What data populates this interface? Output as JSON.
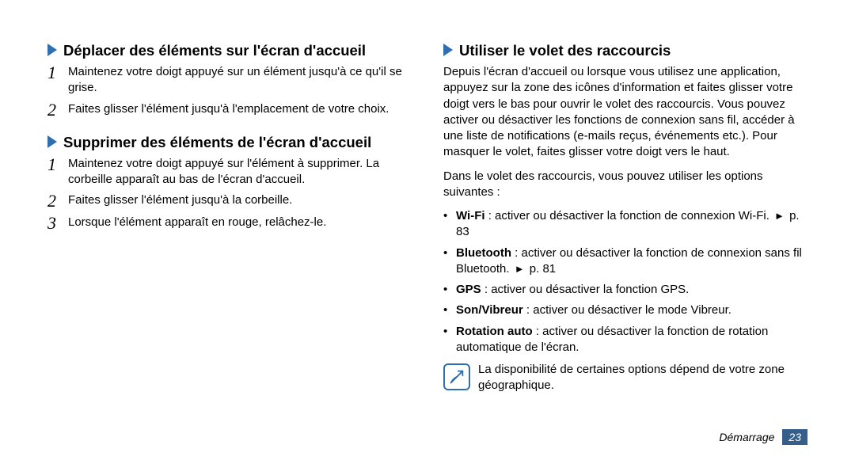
{
  "left": {
    "section1": {
      "title": "Déplacer des éléments sur l'écran d'accueil",
      "steps": [
        "Maintenez votre doigt appuyé sur un élément jusqu'à ce qu'il se grise.",
        "Faites glisser l'élément jusqu'à l'emplacement de votre choix."
      ]
    },
    "section2": {
      "title": "Supprimer des éléments de l'écran d'accueil",
      "steps": [
        "Maintenez votre doigt appuyé sur l'élément à supprimer. La corbeille apparaît au bas de l'écran d'accueil.",
        "Faites glisser l'élément jusqu'à la corbeille.",
        "Lorsque l'élément apparaît en rouge, relâchez-le."
      ]
    }
  },
  "right": {
    "section": {
      "title": "Utiliser le volet des raccourcis",
      "intro": "Depuis l'écran d'accueil ou lorsque vous utilisez une application, appuyez sur la zone des icônes d'information et faites glisser votre doigt vers le bas pour ouvrir le volet des raccourcis. Vous pouvez activer ou désactiver les fonctions de connexion sans fil, accéder à une liste de notifications (e-mails reçus, événements etc.). Pour masquer le volet, faites glisser votre doigt vers le haut.",
      "lead": "Dans le volet des raccourcis, vous pouvez utiliser les options suivantes :",
      "items": [
        {
          "label": "Wi-Fi",
          "desc": " : activer ou désactiver la fonction de connexion Wi-Fi. ",
          "ref": "p. 83"
        },
        {
          "label": "Bluetooth",
          "desc": " : activer ou désactiver la fonction de connexion sans fil Bluetooth. ",
          "ref": "p. 81"
        },
        {
          "label": "GPS",
          "desc": " : activer ou désactiver la fonction GPS.",
          "ref": ""
        },
        {
          "label": "Son/Vibreur",
          "desc": " : activer ou désactiver le mode Vibreur.",
          "ref": ""
        },
        {
          "label": "Rotation auto",
          "desc": " : activer ou désactiver la fonction de rotation automatique de l'écran.",
          "ref": ""
        }
      ],
      "note": "La disponibilité de certaines options dépend de votre zone géographique."
    }
  },
  "footer": {
    "chapter": "Démarrage",
    "page": "23"
  }
}
